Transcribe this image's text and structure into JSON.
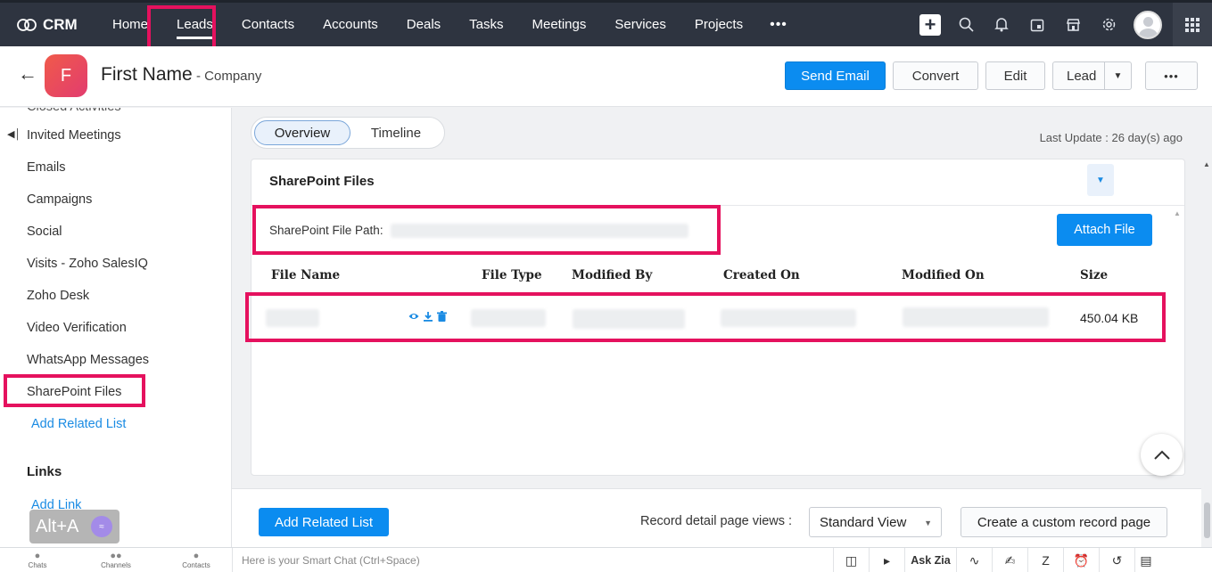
{
  "topnav": {
    "brand": "CRM",
    "items": [
      "Home",
      "Leads",
      "Contacts",
      "Accounts",
      "Deals",
      "Tasks",
      "Meetings",
      "Services",
      "Projects"
    ],
    "more": "•••"
  },
  "record": {
    "avatar_letter": "F",
    "name": "First Name",
    "company": "- Company",
    "buttons": {
      "send_email": "Send Email",
      "convert": "Convert",
      "edit": "Edit",
      "lead": "Lead",
      "more": "•••"
    }
  },
  "sidebar": {
    "items": [
      "Invited Meetings",
      "Emails",
      "Campaigns",
      "Social",
      "Visits - Zoho SalesIQ",
      "Zoho Desk",
      "Video Verification",
      "WhatsApp Messages",
      "SharePoint Files"
    ],
    "add_related_list": "Add Related List",
    "links_heading": "Links",
    "add_link": "Add Link",
    "shortcut_badge": "Alt+A"
  },
  "tabs": {
    "overview": "Overview",
    "timeline": "Timeline"
  },
  "last_update": "Last Update : 26 day(s) ago",
  "sharepoint": {
    "title": "SharePoint Files",
    "path_label": "SharePoint File Path:",
    "attach_button": "Attach File",
    "columns": [
      "File Name",
      "File Type",
      "Modified By",
      "Created On",
      "Modified On",
      "Size"
    ],
    "rows": [
      {
        "size": "450.04 KB"
      }
    ]
  },
  "bottom": {
    "add_related_list": "Add Related List",
    "record_views_label": "Record detail page views :",
    "record_view_selected": "Standard View",
    "custom_page_button": "Create a custom record page"
  },
  "footer": {
    "tabs": [
      "Chats",
      "Channels",
      "Contacts"
    ],
    "smart_chat_placeholder": "Here is your Smart Chat (Ctrl+Space)",
    "ask_zia": "Ask Zia"
  },
  "colors": {
    "accent": "#0b8cf0",
    "highlight": "#e5115e",
    "nav_bg": "#2e3440"
  },
  "icons": [
    "crm-logo-icon",
    "plus-icon",
    "search-icon",
    "bell-icon",
    "calendar-icon",
    "store-icon",
    "gear-icon",
    "apps-grid-icon",
    "back-arrow-icon",
    "eye-icon",
    "download-icon",
    "trash-icon",
    "chevron-up-icon"
  ]
}
